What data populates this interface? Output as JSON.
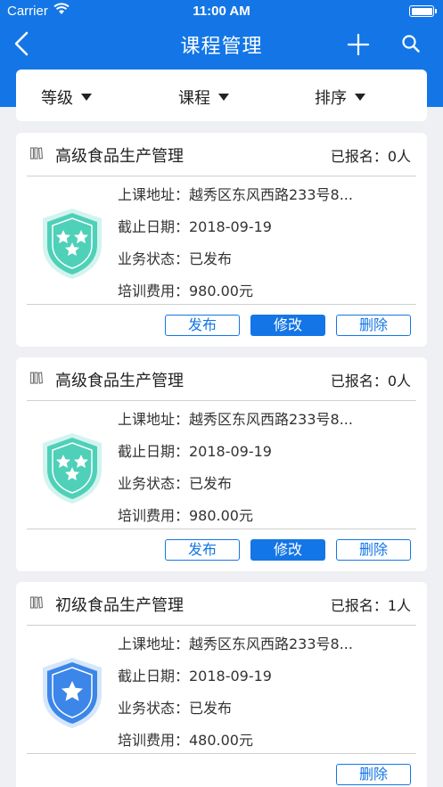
{
  "status_bar": {
    "carrier": "Carrier",
    "time": "11:00 AM"
  },
  "nav": {
    "title": "课程管理"
  },
  "filters": [
    {
      "label": "等级"
    },
    {
      "label": "课程"
    },
    {
      "label": "排序"
    }
  ],
  "colors": {
    "accent": "#1476e6",
    "badge_teal": "#4fd0b8",
    "badge_blue": "#3b86e8"
  },
  "courses": [
    {
      "title": "高级食品生产管理",
      "enrolled": "已报名：0人",
      "address": "上课地址：越秀区东风西路233号8...",
      "deadline": "截止日期：2018-09-19",
      "status": "业务状态：已发布",
      "fee": "培训费用：980.00元",
      "badge_icon": "three-star-shield-icon",
      "buttons": {
        "publish": "发布",
        "edit": "修改",
        "delete": "删除"
      }
    },
    {
      "title": "高级食品生产管理",
      "enrolled": "已报名：0人",
      "address": "上课地址：越秀区东风西路233号8...",
      "deadline": "截止日期：2018-09-19",
      "status": "业务状态：已发布",
      "fee": "培训费用：980.00元",
      "badge_icon": "three-star-shield-icon",
      "buttons": {
        "publish": "发布",
        "edit": "修改",
        "delete": "删除"
      }
    },
    {
      "title": "初级食品生产管理",
      "enrolled": "已报名：1人",
      "address": "上课地址：越秀区东风西路233号8...",
      "deadline": "截止日期：2018-09-19",
      "status": "业务状态：已发布",
      "fee": "培训费用：480.00元",
      "badge_icon": "one-star-shield-icon",
      "buttons": {
        "delete": "删除"
      }
    }
  ]
}
